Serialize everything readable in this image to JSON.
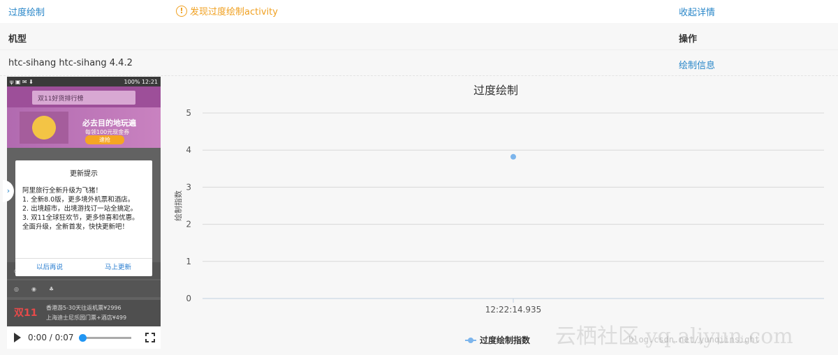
{
  "top": {
    "title": "过度绘制",
    "warning": "发现过度绘制activity",
    "collapse": "收起详情"
  },
  "table": {
    "col1": "机型",
    "col2": "操作",
    "device": "htc-sihang htc-sihang 4.4.2",
    "action": "绘制信息"
  },
  "phone": {
    "status_time": "12:21",
    "status_battery": "100%",
    "search_placeholder": "双11好货排行榜",
    "banner_title": "必去目的地玩遍",
    "banner_sub": "每领100元现金券",
    "banner_btn": "速抢",
    "dialog_title": "更新提示",
    "dialog_lines": [
      "阿里旅行全新升级为飞猪！",
      "1. 全新8.0版，更多境外机票和酒店。",
      "2. 出境超市，出境游找订一站全搞定。",
      "3. 双11全球狂欢节，更多惊喜和优惠。",
      "全面升级，全新首发，快快更新吧！"
    ],
    "dialog_later": "以后再说",
    "dialog_update": "马上更新",
    "ad_logo": "双11",
    "ad_line1": "香港游5-30天往返机票¥2996",
    "ad_line2": "上海迪士尼乐园门票+酒店¥499"
  },
  "video": {
    "time": "0:00 / 0:07",
    "progress": 0
  },
  "chart_data": {
    "type": "scatter",
    "title": "过度绘制",
    "ylabel": "绘制指数",
    "xlabel": "",
    "categories": [
      "12:22:14.935"
    ],
    "yticks": [
      0,
      1,
      2,
      3,
      4,
      5
    ],
    "ylim": [
      0,
      5
    ],
    "series": [
      {
        "name": "过度绘制指数",
        "values": [
          3.82
        ],
        "color": "#7cb5ec"
      }
    ],
    "legend": "bottom",
    "grid": true
  },
  "watermark": "云栖社区 yq.aliyun.com",
  "watermark2": "blog.csdn.net/yunqiinsight"
}
